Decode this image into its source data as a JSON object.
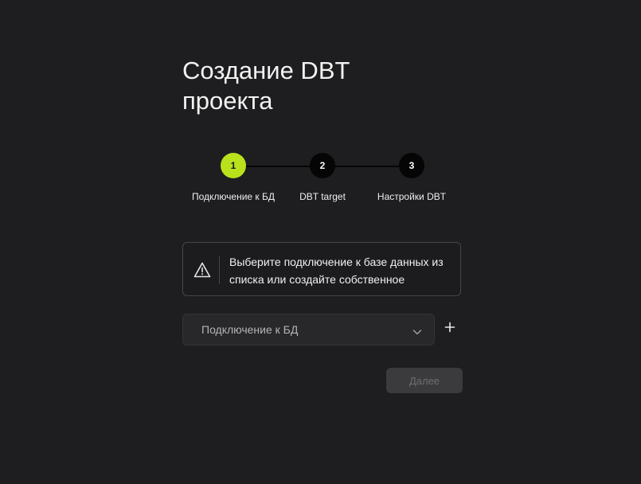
{
  "page": {
    "title": "Создание DBT проекта"
  },
  "stepper": {
    "steps": [
      {
        "number": "1",
        "label": "Подключение к БД",
        "state": "active"
      },
      {
        "number": "2",
        "label": "DBT target",
        "state": "pending"
      },
      {
        "number": "3",
        "label": "Настройки DBT",
        "state": "pending"
      }
    ],
    "accent_color": "#b9e21c"
  },
  "alert": {
    "icon": "warning-icon",
    "text": "Выберите подключение к базе данных из списка или создайте собственное"
  },
  "connection_select": {
    "placeholder": "Подключение к БД",
    "icon": "chevron-down-icon"
  },
  "add_connection": {
    "icon": "plus-icon"
  },
  "actions": {
    "next_label": "Далее",
    "next_disabled": true
  }
}
